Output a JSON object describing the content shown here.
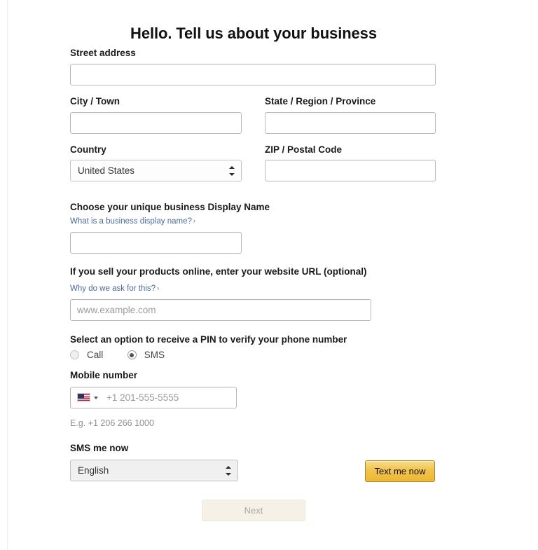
{
  "page": {
    "title": "Hello. Tell us about your business"
  },
  "address": {
    "street_label": "Street address",
    "street_value": "",
    "city_label": "City / Town",
    "city_value": "",
    "state_label": "State / Region / Province",
    "state_value": "",
    "country_label": "Country",
    "country_value": "United States",
    "zip_label": "ZIP / Postal Code",
    "zip_value": ""
  },
  "display_name": {
    "label": "Choose your unique business Display Name",
    "help_link": "What is a business display name?",
    "chevron": "›",
    "value": ""
  },
  "website": {
    "label": "If you sell your products online, enter your website URL (optional)",
    "help_link": "Why do we ask for this?",
    "chevron": "›",
    "value": "",
    "placeholder": "www.example.com"
  },
  "pin": {
    "label": "Select an option to receive a PIN to verify your phone number",
    "options": [
      {
        "label": "Call",
        "selected": false
      },
      {
        "label": "SMS",
        "selected": true
      }
    ]
  },
  "mobile": {
    "label": "Mobile number",
    "country_flag": "us-flag-icon",
    "placeholder": "+1 201-555-5555",
    "value": "",
    "hint": "E.g. +1 206 266 1000"
  },
  "sms": {
    "label": "SMS me now",
    "language_value": "English",
    "send_button": "Text me now"
  },
  "footer": {
    "next_button": "Next",
    "next_disabled": true
  },
  "colors": {
    "accent_button": "#f0c14b",
    "accent_button_border": "#a88734",
    "link": "#4a6d9c",
    "disabled_button_bg": "#f6f1e7",
    "disabled_button_text": "#aaaaaa",
    "input_border": "#b8b8b8",
    "text": "#111111"
  }
}
